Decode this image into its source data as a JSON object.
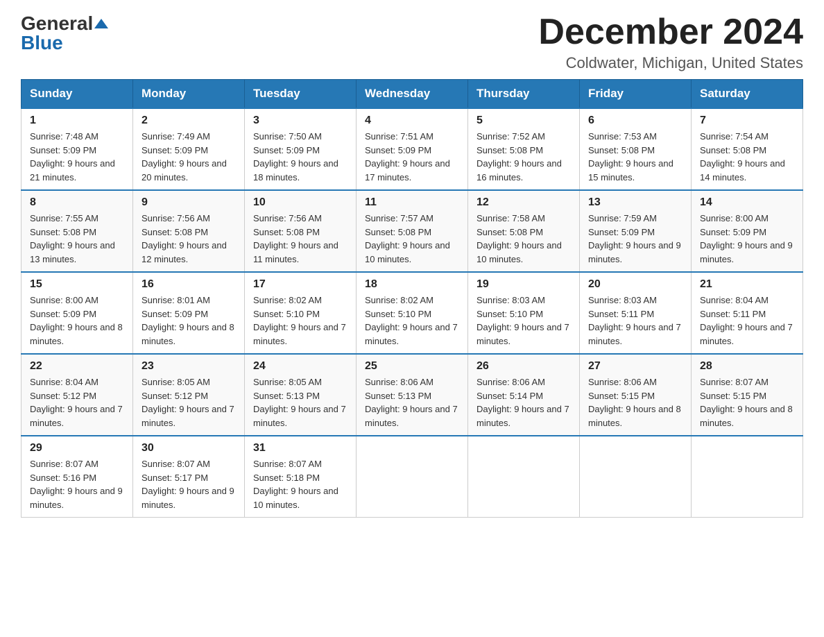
{
  "header": {
    "logo": {
      "general": "General",
      "blue": "Blue",
      "tagline": ""
    },
    "title": "December 2024",
    "location": "Coldwater, Michigan, United States"
  },
  "calendar": {
    "days_of_week": [
      "Sunday",
      "Monday",
      "Tuesday",
      "Wednesday",
      "Thursday",
      "Friday",
      "Saturday"
    ],
    "weeks": [
      [
        {
          "day": "1",
          "sunrise": "Sunrise: 7:48 AM",
          "sunset": "Sunset: 5:09 PM",
          "daylight": "Daylight: 9 hours and 21 minutes."
        },
        {
          "day": "2",
          "sunrise": "Sunrise: 7:49 AM",
          "sunset": "Sunset: 5:09 PM",
          "daylight": "Daylight: 9 hours and 20 minutes."
        },
        {
          "day": "3",
          "sunrise": "Sunrise: 7:50 AM",
          "sunset": "Sunset: 5:09 PM",
          "daylight": "Daylight: 9 hours and 18 minutes."
        },
        {
          "day": "4",
          "sunrise": "Sunrise: 7:51 AM",
          "sunset": "Sunset: 5:09 PM",
          "daylight": "Daylight: 9 hours and 17 minutes."
        },
        {
          "day": "5",
          "sunrise": "Sunrise: 7:52 AM",
          "sunset": "Sunset: 5:08 PM",
          "daylight": "Daylight: 9 hours and 16 minutes."
        },
        {
          "day": "6",
          "sunrise": "Sunrise: 7:53 AM",
          "sunset": "Sunset: 5:08 PM",
          "daylight": "Daylight: 9 hours and 15 minutes."
        },
        {
          "day": "7",
          "sunrise": "Sunrise: 7:54 AM",
          "sunset": "Sunset: 5:08 PM",
          "daylight": "Daylight: 9 hours and 14 minutes."
        }
      ],
      [
        {
          "day": "8",
          "sunrise": "Sunrise: 7:55 AM",
          "sunset": "Sunset: 5:08 PM",
          "daylight": "Daylight: 9 hours and 13 minutes."
        },
        {
          "day": "9",
          "sunrise": "Sunrise: 7:56 AM",
          "sunset": "Sunset: 5:08 PM",
          "daylight": "Daylight: 9 hours and 12 minutes."
        },
        {
          "day": "10",
          "sunrise": "Sunrise: 7:56 AM",
          "sunset": "Sunset: 5:08 PM",
          "daylight": "Daylight: 9 hours and 11 minutes."
        },
        {
          "day": "11",
          "sunrise": "Sunrise: 7:57 AM",
          "sunset": "Sunset: 5:08 PM",
          "daylight": "Daylight: 9 hours and 10 minutes."
        },
        {
          "day": "12",
          "sunrise": "Sunrise: 7:58 AM",
          "sunset": "Sunset: 5:08 PM",
          "daylight": "Daylight: 9 hours and 10 minutes."
        },
        {
          "day": "13",
          "sunrise": "Sunrise: 7:59 AM",
          "sunset": "Sunset: 5:09 PM",
          "daylight": "Daylight: 9 hours and 9 minutes."
        },
        {
          "day": "14",
          "sunrise": "Sunrise: 8:00 AM",
          "sunset": "Sunset: 5:09 PM",
          "daylight": "Daylight: 9 hours and 9 minutes."
        }
      ],
      [
        {
          "day": "15",
          "sunrise": "Sunrise: 8:00 AM",
          "sunset": "Sunset: 5:09 PM",
          "daylight": "Daylight: 9 hours and 8 minutes."
        },
        {
          "day": "16",
          "sunrise": "Sunrise: 8:01 AM",
          "sunset": "Sunset: 5:09 PM",
          "daylight": "Daylight: 9 hours and 8 minutes."
        },
        {
          "day": "17",
          "sunrise": "Sunrise: 8:02 AM",
          "sunset": "Sunset: 5:10 PM",
          "daylight": "Daylight: 9 hours and 7 minutes."
        },
        {
          "day": "18",
          "sunrise": "Sunrise: 8:02 AM",
          "sunset": "Sunset: 5:10 PM",
          "daylight": "Daylight: 9 hours and 7 minutes."
        },
        {
          "day": "19",
          "sunrise": "Sunrise: 8:03 AM",
          "sunset": "Sunset: 5:10 PM",
          "daylight": "Daylight: 9 hours and 7 minutes."
        },
        {
          "day": "20",
          "sunrise": "Sunrise: 8:03 AM",
          "sunset": "Sunset: 5:11 PM",
          "daylight": "Daylight: 9 hours and 7 minutes."
        },
        {
          "day": "21",
          "sunrise": "Sunrise: 8:04 AM",
          "sunset": "Sunset: 5:11 PM",
          "daylight": "Daylight: 9 hours and 7 minutes."
        }
      ],
      [
        {
          "day": "22",
          "sunrise": "Sunrise: 8:04 AM",
          "sunset": "Sunset: 5:12 PM",
          "daylight": "Daylight: 9 hours and 7 minutes."
        },
        {
          "day": "23",
          "sunrise": "Sunrise: 8:05 AM",
          "sunset": "Sunset: 5:12 PM",
          "daylight": "Daylight: 9 hours and 7 minutes."
        },
        {
          "day": "24",
          "sunrise": "Sunrise: 8:05 AM",
          "sunset": "Sunset: 5:13 PM",
          "daylight": "Daylight: 9 hours and 7 minutes."
        },
        {
          "day": "25",
          "sunrise": "Sunrise: 8:06 AM",
          "sunset": "Sunset: 5:13 PM",
          "daylight": "Daylight: 9 hours and 7 minutes."
        },
        {
          "day": "26",
          "sunrise": "Sunrise: 8:06 AM",
          "sunset": "Sunset: 5:14 PM",
          "daylight": "Daylight: 9 hours and 7 minutes."
        },
        {
          "day": "27",
          "sunrise": "Sunrise: 8:06 AM",
          "sunset": "Sunset: 5:15 PM",
          "daylight": "Daylight: 9 hours and 8 minutes."
        },
        {
          "day": "28",
          "sunrise": "Sunrise: 8:07 AM",
          "sunset": "Sunset: 5:15 PM",
          "daylight": "Daylight: 9 hours and 8 minutes."
        }
      ],
      [
        {
          "day": "29",
          "sunrise": "Sunrise: 8:07 AM",
          "sunset": "Sunset: 5:16 PM",
          "daylight": "Daylight: 9 hours and 9 minutes."
        },
        {
          "day": "30",
          "sunrise": "Sunrise: 8:07 AM",
          "sunset": "Sunset: 5:17 PM",
          "daylight": "Daylight: 9 hours and 9 minutes."
        },
        {
          "day": "31",
          "sunrise": "Sunrise: 8:07 AM",
          "sunset": "Sunset: 5:18 PM",
          "daylight": "Daylight: 9 hours and 10 minutes."
        },
        null,
        null,
        null,
        null
      ]
    ]
  }
}
